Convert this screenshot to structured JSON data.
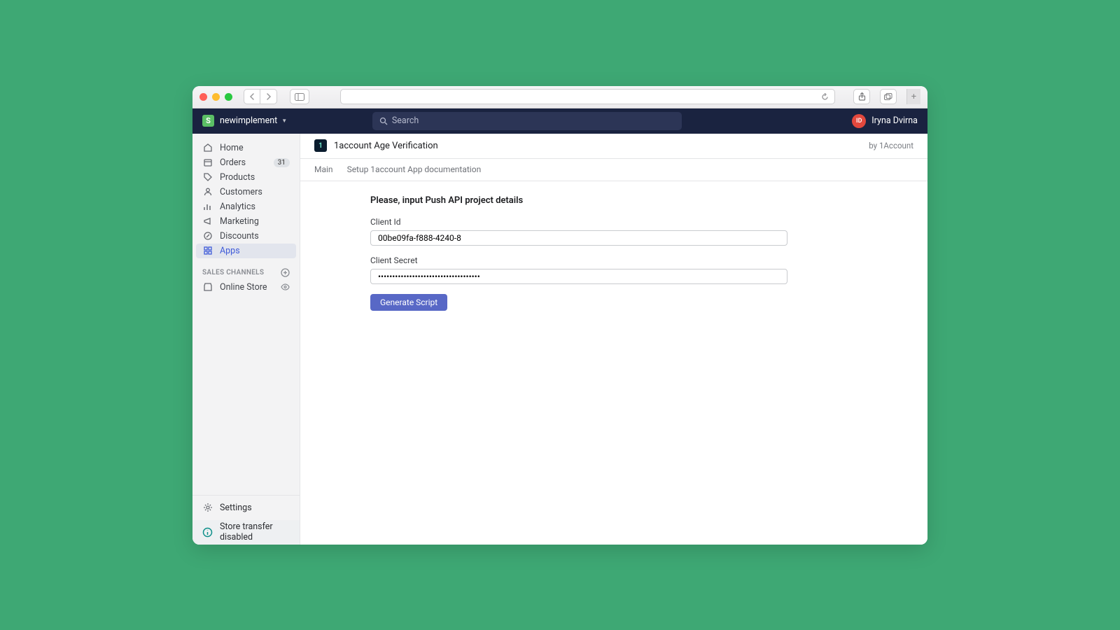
{
  "titlebar": {},
  "shopbar": {
    "store_name": "newimplement",
    "search_placeholder": "Search",
    "user": {
      "initials": "ID",
      "name": "Iryna Dvirna"
    }
  },
  "sidebar": {
    "items": [
      {
        "label": "Home"
      },
      {
        "label": "Orders",
        "badge": "31"
      },
      {
        "label": "Products"
      },
      {
        "label": "Customers"
      },
      {
        "label": "Analytics"
      },
      {
        "label": "Marketing"
      },
      {
        "label": "Discounts"
      },
      {
        "label": "Apps"
      }
    ],
    "channels_header": "SALES CHANNELS",
    "channels": [
      {
        "label": "Online Store"
      }
    ],
    "settings_label": "Settings",
    "transfer_label": "Store transfer disabled"
  },
  "app": {
    "title": "1account Age Verification",
    "byline": "by 1Account",
    "tabs": {
      "main": "Main",
      "setup": "Setup 1account App documentation"
    }
  },
  "form": {
    "heading": "Please, input Push API project details",
    "client_id_label": "Client Id",
    "client_id_value": "00be09fa-f888-4240-8",
    "client_secret_label": "Client Secret",
    "client_secret_value": "••••••••••••••••••••••••••••••••••••",
    "button_label": "Generate Script"
  }
}
